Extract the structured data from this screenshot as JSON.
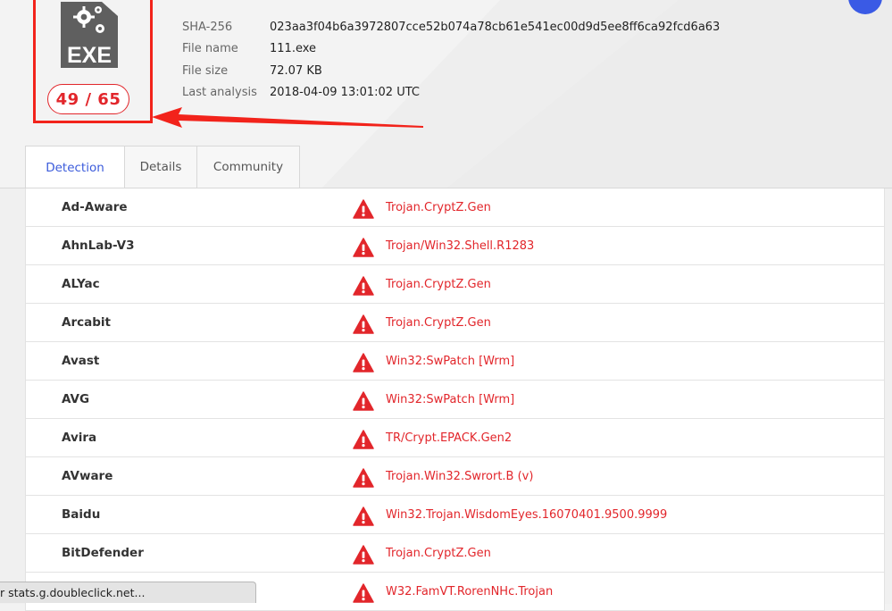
{
  "header": {
    "file_type_icon": "exe-file-icon",
    "file_type_label": "EXE",
    "detection_score": "49 / 65"
  },
  "meta": {
    "sha256_label": "SHA-256",
    "sha256_value": "023aa3f04b6a3972807cce52b074a78cb61e541ec00d9d5ee8ff6ca92fcd6a63",
    "filename_label": "File name",
    "filename_value": "111.exe",
    "filesize_label": "File size",
    "filesize_value": "72.07 KB",
    "analysis_label": "Last analysis",
    "analysis_value": "2018-04-09 13:01:02 UTC"
  },
  "tabs": [
    {
      "label": "Detection",
      "active": true
    },
    {
      "label": "Details",
      "active": false
    },
    {
      "label": "Community",
      "active": false
    }
  ],
  "detections": [
    {
      "engine": "Ad-Aware",
      "result": "Trojan.CryptZ.Gen"
    },
    {
      "engine": "AhnLab-V3",
      "result": "Trojan/Win32.Shell.R1283"
    },
    {
      "engine": "ALYac",
      "result": "Trojan.CryptZ.Gen"
    },
    {
      "engine": "Arcabit",
      "result": "Trojan.CryptZ.Gen"
    },
    {
      "engine": "Avast",
      "result": "Win32:SwPatch [Wrm]"
    },
    {
      "engine": "AVG",
      "result": "Win32:SwPatch [Wrm]"
    },
    {
      "engine": "Avira",
      "result": "TR/Crypt.EPACK.Gen2"
    },
    {
      "engine": "AVware",
      "result": "Trojan.Win32.Swrort.B (v)"
    },
    {
      "engine": "Baidu",
      "result": "Win32.Trojan.WisdomEyes.16070401.9500.9999"
    },
    {
      "engine": "BitDefender",
      "result": "Trojan.CryptZ.Gen"
    },
    {
      "engine": "",
      "result": "W32.FamVT.RorenNHc.Trojan"
    }
  ],
  "status_bar": {
    "text": "r stats.g.doubleclick.net..."
  },
  "colors": {
    "accent": "#3b5bdb",
    "malicious": "#e2262b",
    "annotation": "#f2231b"
  },
  "icons": {
    "warning": "warning-triangle-icon"
  }
}
